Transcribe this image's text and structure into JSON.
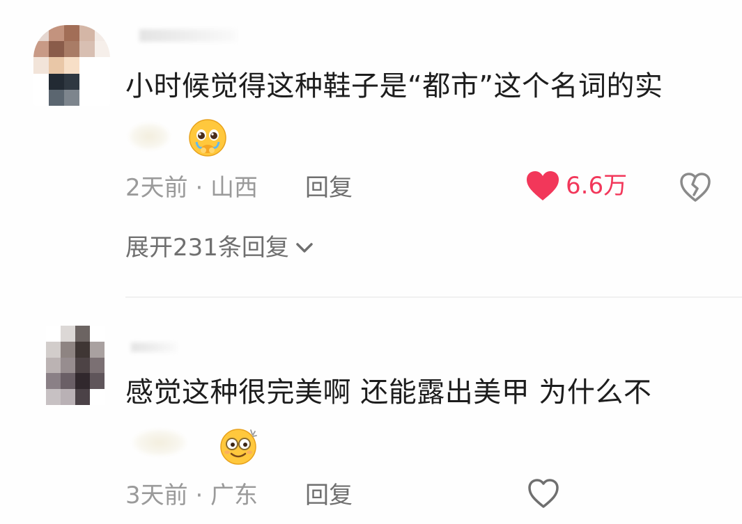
{
  "comments": [
    {
      "text": "小时候觉得这种鞋子是“都市”这个名词的实",
      "time_location": "2天前 · 山西",
      "reply_label": "回复",
      "like_count": "6.6万",
      "liked": true,
      "expand_label": "展开231条回复",
      "avatar_colors": [
        "#e5d6cf",
        "#c3937e",
        "#a26e57",
        "#d4b6a6",
        "#f3ebe6",
        "#c89a86",
        "#8a5c4a",
        "#a97c66",
        "#d8bfb2",
        "#f6efea",
        "#f2e4d9",
        "#e9c7a7",
        "#f7dfc7",
        "#ffffff",
        "#ffffff",
        "#ffffff",
        "#222a33",
        "#2f3841",
        "#ffffff",
        "#ffffff",
        "#ffffff",
        "#5b6670",
        "#7d858d",
        "#ffffff",
        "#ffffff"
      ]
    },
    {
      "text": "感觉这种很完美啊 还能露出美甲 为什么不",
      "time_location": "3天前 · 广东",
      "reply_label": "回复",
      "liked": false,
      "avatar_colors": [
        "#ffffff",
        "#dcd8d6",
        "#6c6462",
        "#ffffff",
        "#d2cdcb",
        "#8e8482",
        "#3f3634",
        "#a9a1a0",
        "#bbb3b3",
        "#978d8f",
        "#4d4345",
        "#7b7073",
        "#8a8086",
        "#6a5f66",
        "#31282d",
        "#5f555a",
        "#c7c1c3",
        "#b9b1b5",
        "#4b4247",
        "#ffffff"
      ]
    }
  ],
  "colors": {
    "like_red": "#f2375a",
    "meta_gray": "#9a9a9a",
    "text_dark": "#1d1d1d"
  },
  "icons": {
    "liked_heart": "heart-filled-icon",
    "dislike": "broken-heart-icon",
    "like_outline": "heart-outline-icon",
    "expand_chevron": "chevron-down-icon"
  }
}
